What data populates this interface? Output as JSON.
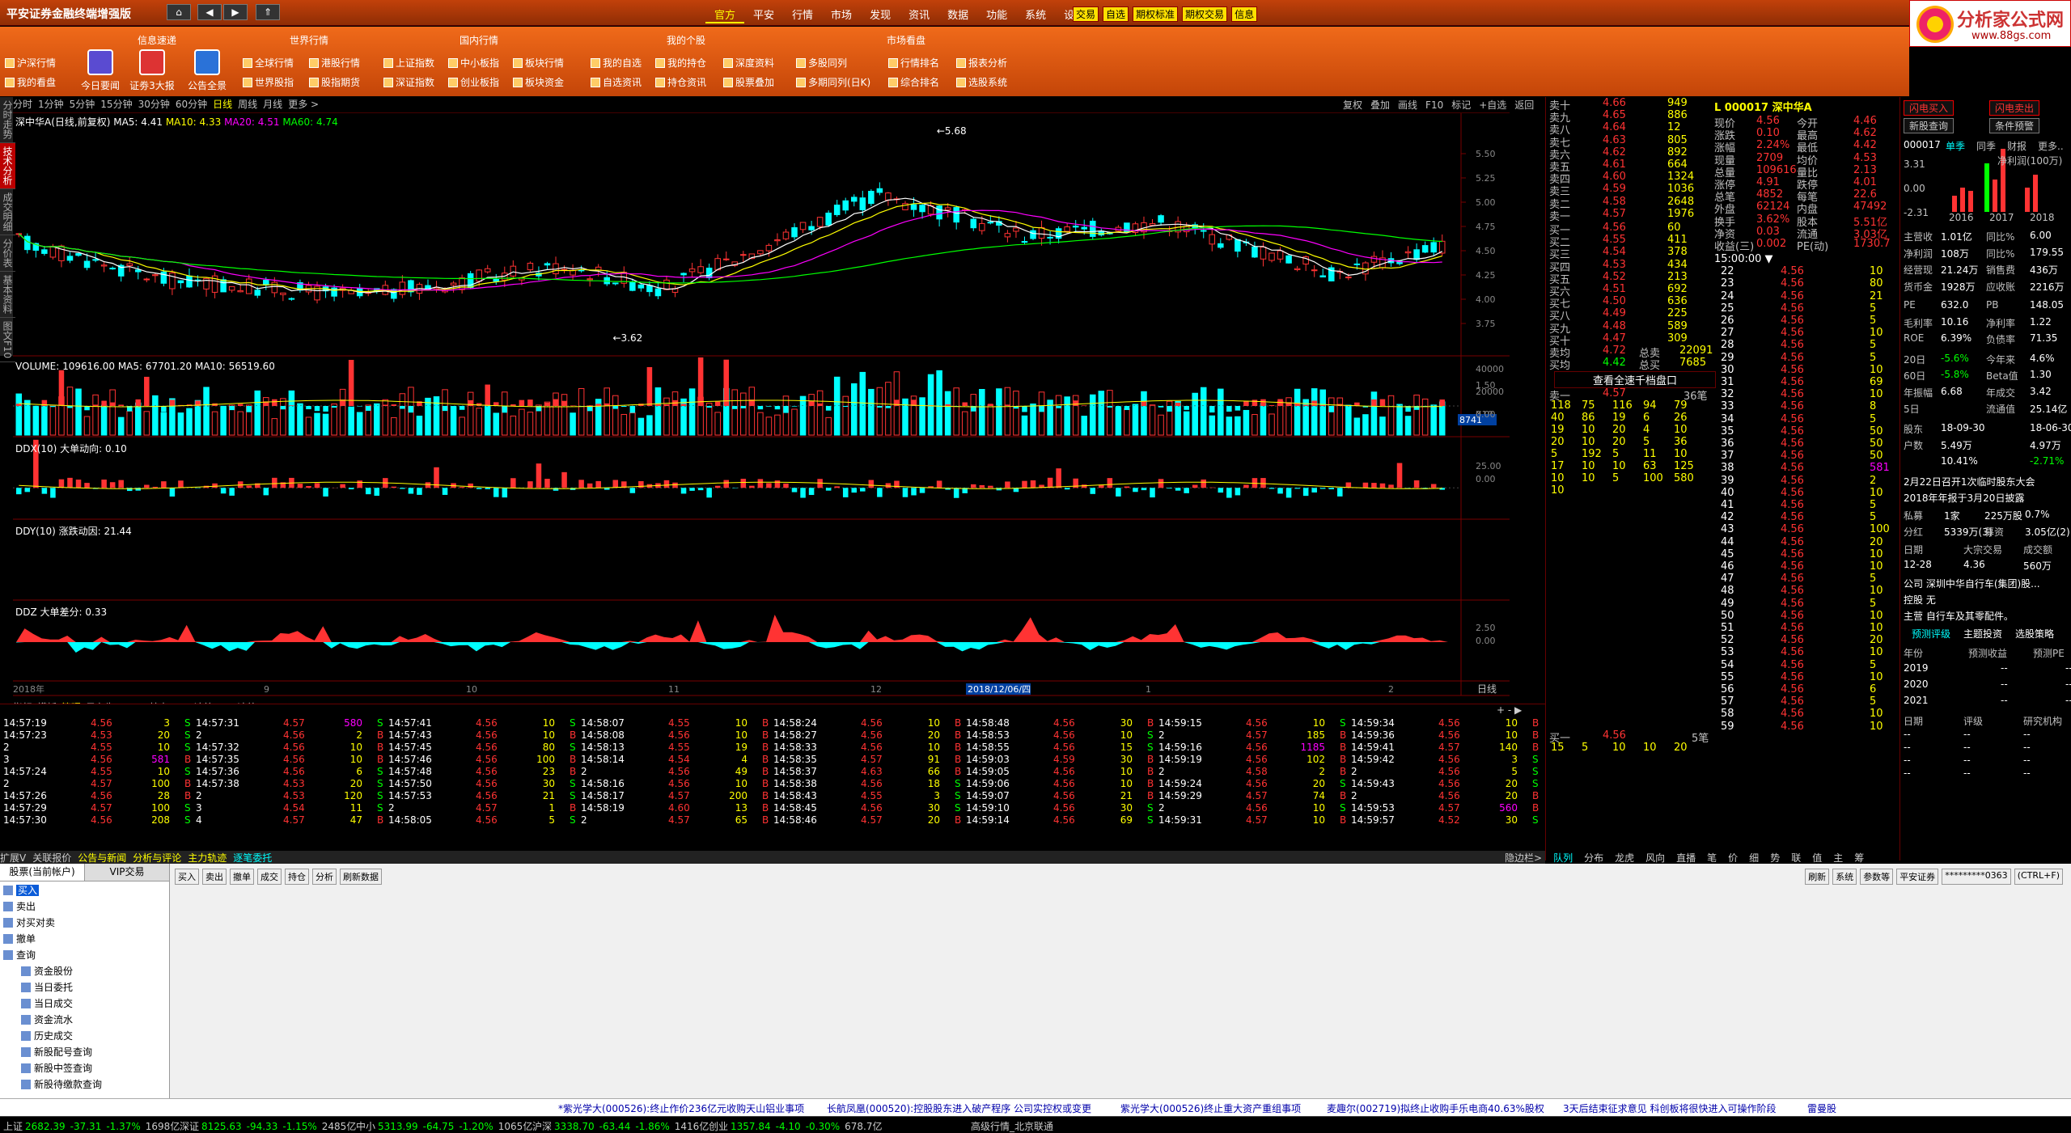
{
  "app": {
    "title": "平安证券金融终端增强版"
  },
  "top_menu": [
    "官方",
    "平安",
    "行情",
    "市场",
    "发现",
    "资讯",
    "数据",
    "功能",
    "系统",
    "设置"
  ],
  "top_flags": [
    "交易",
    "自选",
    "期权标准",
    "期权交易",
    "信息"
  ],
  "logo": {
    "line1": "分析家公式网",
    "line2": "www.88gs.com"
  },
  "toolbar": {
    "groups": [
      {
        "title": "信息速递",
        "items": [
          "沪深行情",
          "我的看盘"
        ],
        "big": [
          "今日要闻",
          "证劵3大报",
          "公告全景"
        ]
      },
      {
        "title": "世界行情",
        "items": [
          "全球行情",
          "世界股指",
          "港股行情",
          "股指期货"
        ]
      },
      {
        "title": "国内行情",
        "items": [
          "上证指数",
          "深证指数",
          "中小板指",
          "创业板指",
          "板块行情",
          "板块资金"
        ]
      },
      {
        "title": "我的个股",
        "items": [
          "我的自选",
          "自选资讯",
          "我的持仓",
          "持仓资讯",
          "深度资料",
          "股票叠加"
        ]
      },
      {
        "title": "市场看盘",
        "items": [
          "多股同列",
          "多期同列(日K)",
          "行情排名",
          "综合排名",
          "报表分析",
          "选股系统"
        ]
      }
    ]
  },
  "left_tabs": [
    "分时走势",
    "技术分析",
    "成交明细",
    "分价表",
    "基本资料",
    "图文F10"
  ],
  "period_bar": [
    "分时",
    "1分钟",
    "5分钟",
    "15分钟",
    "30分钟",
    "60分钟",
    "日线",
    "周线",
    "月线",
    "更多 >"
  ],
  "right_tools": [
    "复权",
    "叠加",
    "画线",
    "F10",
    "标记",
    "+自选",
    "返回"
  ],
  "main_chart": {
    "label": "深中华A(日线,前复权)",
    "ma5": "MA5: 4.41",
    "ma10": "MA10: 4.33",
    "ma20": "MA20: 4.51",
    "ma60": "MA60: 4.74",
    "high_label": "5.68",
    "low_label": "3.62",
    "y_ticks": [
      "5.50",
      "5.25",
      "5.00",
      "4.75",
      "4.50",
      "4.25",
      "4.00",
      "3.75"
    ]
  },
  "volume": {
    "label": "VOLUME: 109616.00  MA5: 67701.20  MA10: 56519.60",
    "y_ticks": [
      "40000",
      "20000",
      "X10"
    ],
    "badge": "8741"
  },
  "ddx": {
    "label": "DDX(10)  大单动向: 0.10",
    "y_ticks": [
      "1.50",
      "0.00"
    ]
  },
  "ddy": {
    "label": "DDY(10)  涨跌动因: 21.44",
    "y_ticks": [
      "25.00",
      "0.00"
    ]
  },
  "ddz": {
    "label": "DDZ  大单差分: 0.33",
    "y_ticks": [
      "2.50",
      "0.00"
    ]
  },
  "x_axis": {
    "labels": [
      "2018年",
      "9",
      "10",
      "11",
      "12",
      "2018/12/06/四",
      "1",
      "2"
    ],
    "period": "日线"
  },
  "ind_tabs": [
    "指标",
    "模板",
    "管理",
    "另存为",
    "MACD基本",
    "DDE决策",
    "SUP决策"
  ],
  "chart_data": {
    "type": "candlestick",
    "title": "深中华A(日线,前复权)",
    "ylim": [
      3.5,
      5.75
    ],
    "series": [
      {
        "name": "MA5"
      },
      {
        "name": "MA10"
      },
      {
        "name": "MA20"
      },
      {
        "name": "MA60"
      }
    ],
    "annotations": [
      {
        "text": "5.68",
        "kind": "high"
      },
      {
        "text": "3.62",
        "kind": "low"
      }
    ]
  },
  "quote": {
    "code": "000017",
    "name": "深中华A",
    "sells": [
      [
        "卖十",
        "4.66",
        "949"
      ],
      [
        "卖九",
        "4.65",
        "886"
      ],
      [
        "卖八",
        "4.64",
        "12"
      ],
      [
        "卖七",
        "4.63",
        "805"
      ],
      [
        "卖六",
        "4.62",
        "892"
      ],
      [
        "卖五",
        "4.61",
        "664"
      ],
      [
        "卖四",
        "4.60",
        "1324"
      ],
      [
        "卖三",
        "4.59",
        "1036"
      ],
      [
        "卖二",
        "4.58",
        "2648"
      ],
      [
        "卖一",
        "4.57",
        "1976"
      ]
    ],
    "buys": [
      [
        "买一",
        "4.56",
        "60"
      ],
      [
        "买二",
        "4.55",
        "411"
      ],
      [
        "买三",
        "4.54",
        "378"
      ],
      [
        "买四",
        "4.53",
        "434"
      ],
      [
        "买五",
        "4.52",
        "213"
      ],
      [
        "买六",
        "4.51",
        "692"
      ],
      [
        "买七",
        "4.50",
        "636"
      ],
      [
        "买八",
        "4.49",
        "225"
      ],
      [
        "买九",
        "4.48",
        "589"
      ],
      [
        "买十",
        "4.47",
        "309"
      ]
    ],
    "avg_sell": [
      "卖均",
      "4.72",
      "总卖",
      "22091"
    ],
    "avg_buy": [
      "买均",
      "4.42",
      "总买",
      "7685"
    ],
    "full_depth_btn": "查看全速千档盘口",
    "queue_head": [
      "卖一",
      "4.57",
      "36笔"
    ],
    "queue_rows": [
      [
        "118",
        "75",
        "116",
        "94",
        "79"
      ],
      [
        "40",
        "86",
        "19",
        "6",
        "26"
      ],
      [
        "19",
        "10",
        "20",
        "4",
        "10"
      ],
      [
        "20",
        "10",
        "20",
        "5",
        "36"
      ],
      [
        "5",
        "192",
        "5",
        "11",
        "10"
      ],
      [
        "17",
        "10",
        "10",
        "63",
        "125"
      ],
      [
        "10",
        "10",
        "5",
        "100",
        "580"
      ],
      [
        "10",
        "",
        "",
        "",
        ""
      ]
    ],
    "buy_queue_head": [
      "买一",
      "4.56",
      "5笔"
    ],
    "buy_queue_row": [
      "15",
      "5",
      "10",
      "10",
      "20"
    ],
    "stats": [
      [
        "现价",
        "4.56",
        "今开",
        "4.46"
      ],
      [
        "涨跌",
        "0.10",
        "最高",
        "4.62"
      ],
      [
        "涨幅",
        "2.24%",
        "最低",
        "4.42"
      ],
      [
        "现量",
        "2709",
        "均价",
        "4.53"
      ],
      [
        "总量",
        "109616",
        "量比",
        "2.13"
      ],
      [
        "涨停",
        "4.91",
        "跌停",
        "4.01"
      ],
      [
        "总笔",
        "4852",
        "每笔",
        "22.6"
      ],
      [
        "外盘",
        "62124",
        "内盘",
        "47492"
      ],
      [
        "换手",
        "3.62%",
        "股本",
        "5.51亿"
      ],
      [
        "净资",
        "0.03",
        "流通",
        "3.03亿"
      ],
      [
        "收益(三)",
        "0.002",
        "PE(动)",
        "1730.7"
      ]
    ],
    "ticks_head": "15:00:00",
    "ticks": [
      [
        "22",
        "4.56",
        "10"
      ],
      [
        "23",
        "4.56",
        "80"
      ],
      [
        "24",
        "4.56",
        "21"
      ],
      [
        "25",
        "4.56",
        "5"
      ],
      [
        "26",
        "4.56",
        "5"
      ],
      [
        "27",
        "4.56",
        "10"
      ],
      [
        "28",
        "4.56",
        "5"
      ],
      [
        "29",
        "4.56",
        "5"
      ],
      [
        "30",
        "4.56",
        "10"
      ],
      [
        "31",
        "4.56",
        "69"
      ],
      [
        "32",
        "4.56",
        "10"
      ],
      [
        "33",
        "4.56",
        "8"
      ],
      [
        "34",
        "4.56",
        "5"
      ],
      [
        "35",
        "4.56",
        "50"
      ],
      [
        "36",
        "4.56",
        "50"
      ],
      [
        "37",
        "4.56",
        "50"
      ],
      [
        "38",
        "4.56",
        "581"
      ],
      [
        "39",
        "4.56",
        "2"
      ],
      [
        "40",
        "4.56",
        "10"
      ],
      [
        "41",
        "4.56",
        "5"
      ],
      [
        "42",
        "4.56",
        "5"
      ],
      [
        "43",
        "4.56",
        "100"
      ],
      [
        "44",
        "4.56",
        "20"
      ],
      [
        "45",
        "4.56",
        "10"
      ],
      [
        "46",
        "4.56",
        "10"
      ],
      [
        "47",
        "4.56",
        "5"
      ],
      [
        "48",
        "4.56",
        "10"
      ],
      [
        "49",
        "4.56",
        "5"
      ],
      [
        "50",
        "4.56",
        "10"
      ],
      [
        "51",
        "4.56",
        "10"
      ],
      [
        "52",
        "4.56",
        "20"
      ],
      [
        "53",
        "4.56",
        "10"
      ],
      [
        "54",
        "4.56",
        "5"
      ],
      [
        "55",
        "4.56",
        "10"
      ],
      [
        "56",
        "4.56",
        "6"
      ],
      [
        "57",
        "4.56",
        "5"
      ],
      [
        "58",
        "4.56",
        "10"
      ],
      [
        "59",
        "4.56",
        "10"
      ]
    ]
  },
  "info": {
    "buttons": [
      "闪电买入",
      "闪电卖出",
      "新股查询",
      "条件预警"
    ],
    "code": "000017",
    "tabs": [
      "单季",
      "同季",
      "财报",
      "更多.."
    ],
    "mini_chart": {
      "unit": "净利润(100万)",
      "years": [
        "2016",
        "2017",
        "2018"
      ],
      "y_ticks": [
        "3.31",
        "0.00",
        "-2.31"
      ]
    },
    "rows": [
      [
        "主营收",
        "1.01亿",
        "同比%",
        "6.00"
      ],
      [
        "净利润",
        "108万",
        "同比%",
        "179.55"
      ],
      [
        "经营现",
        "21.24万",
        "销售费",
        "436万"
      ],
      [
        "货币金",
        "1928万",
        "应收账",
        "2216万"
      ],
      [
        "PE",
        "632.0",
        "PB",
        "148.05"
      ],
      [
        "毛利率",
        "10.16",
        "净利率",
        "1.22"
      ],
      [
        "ROE",
        "6.39%",
        "负债率",
        "71.35"
      ],
      [
        "20日",
        "-5.6%",
        "今年来",
        "4.6%"
      ],
      [
        "60日",
        "-5.8%",
        "Beta值",
        "1.30"
      ],
      [
        "年振幅",
        "6.68",
        "年成交",
        "3.42"
      ],
      [
        "5日",
        "",
        "流通值",
        "25.14亿"
      ],
      [
        "股东",
        "18-09-30",
        "",
        "18-06-30"
      ],
      [
        "户数",
        "5.49万",
        "",
        "4.97万"
      ],
      [
        "",
        "10.41%",
        "",
        "-2.71%"
      ]
    ],
    "meeting": "2月22日召开1次临时股东大会",
    "report": "2018年年报于3月20日披露",
    "pledge": [
      "私募",
      "1家",
      "225万股",
      "0.7%"
    ],
    "dividend": [
      "分红",
      "5339万(3)",
      "募资",
      "3.05亿(2)"
    ],
    "block": [
      "日期",
      "大宗交易",
      "成交额"
    ],
    "block_row": [
      "12-28",
      "4.36",
      "560万"
    ],
    "company": "公司 深圳中华自行车(集团)股...",
    "control": "控股 无",
    "business": "主营 自行车及其零配件。",
    "forecast_tabs": [
      "预测评级",
      "主题投资",
      "选股策略"
    ],
    "forecast_head": [
      "年份",
      "预测收益",
      "预测PE"
    ],
    "forecast_rows": [
      [
        "2019",
        "--",
        "--"
      ],
      [
        "2020",
        "--",
        "--"
      ],
      [
        "2021",
        "--",
        "--"
      ]
    ],
    "rating_head": [
      "日期",
      "评级",
      "研究机构"
    ],
    "rating_rows": [
      [
        "--",
        "--",
        "--"
      ],
      [
        "--",
        "--",
        "--"
      ],
      [
        "--",
        "--",
        "--"
      ],
      [
        "--",
        "--",
        "--"
      ]
    ]
  },
  "trades": [
    [
      [
        "14:57:19",
        "4.56",
        "3",
        "S"
      ],
      [
        "14:57:23",
        "4.53",
        "20",
        "S"
      ],
      [
        "2",
        "4.55",
        "10",
        "S"
      ],
      [
        "3",
        "4.56",
        "581",
        "B"
      ],
      [
        "14:57:24",
        "4.55",
        "10",
        "S"
      ],
      [
        "2",
        "4.57",
        "100",
        "B"
      ],
      [
        "14:57:26",
        "4.56",
        "28",
        "B"
      ],
      [
        "14:57:29",
        "4.57",
        "100",
        "S"
      ],
      [
        "14:57:30",
        "4.56",
        "208",
        "S"
      ]
    ],
    [
      [
        "14:57:31",
        "4.57",
        "580",
        "S"
      ],
      [
        "2",
        "4.56",
        "2",
        "B"
      ],
      [
        "14:57:32",
        "4.56",
        "10",
        "B"
      ],
      [
        "14:57:35",
        "4.56",
        "10",
        "B"
      ],
      [
        "14:57:36",
        "4.56",
        "6",
        "S"
      ],
      [
        "14:57:38",
        "4.53",
        "20",
        "S"
      ],
      [
        "2",
        "4.53",
        "120",
        "S"
      ],
      [
        "3",
        "4.54",
        "11",
        "S"
      ],
      [
        "4",
        "4.57",
        "47",
        "B"
      ]
    ],
    [
      [
        "14:57:41",
        "4.56",
        "10",
        "S"
      ],
      [
        "14:57:43",
        "4.56",
        "10",
        "B"
      ],
      [
        "14:57:45",
        "4.56",
        "80",
        "S"
      ],
      [
        "14:57:46",
        "4.56",
        "100",
        "B"
      ],
      [
        "14:57:48",
        "4.56",
        "23",
        "B"
      ],
      [
        "14:57:50",
        "4.56",
        "30",
        "S"
      ],
      [
        "14:57:53",
        "4.56",
        "21",
        "S"
      ],
      [
        "2",
        "4.57",
        "1",
        "B"
      ],
      [
        "14:58:05",
        "4.56",
        "5",
        "S"
      ]
    ],
    [
      [
        "14:58:07",
        "4.55",
        "10",
        "B"
      ],
      [
        "14:58:08",
        "4.56",
        "10",
        "B"
      ],
      [
        "14:58:13",
        "4.55",
        "19",
        "B"
      ],
      [
        "14:58:14",
        "4.54",
        "4",
        "B"
      ],
      [
        "2",
        "4.56",
        "49",
        "B"
      ],
      [
        "14:58:16",
        "4.56",
        "10",
        "B"
      ],
      [
        "14:58:17",
        "4.57",
        "200",
        "B"
      ],
      [
        "14:58:19",
        "4.60",
        "13",
        "B"
      ],
      [
        "2",
        "4.57",
        "65",
        "B"
      ]
    ],
    [
      [
        "14:58:24",
        "4.56",
        "10",
        "B"
      ],
      [
        "14:58:27",
        "4.56",
        "20",
        "B"
      ],
      [
        "14:58:33",
        "4.56",
        "10",
        "B"
      ],
      [
        "14:58:35",
        "4.57",
        "91",
        "B"
      ],
      [
        "14:58:37",
        "4.63",
        "66",
        "B"
      ],
      [
        "14:58:38",
        "4.56",
        "18",
        "S"
      ],
      [
        "14:58:43",
        "4.55",
        "3",
        "S"
      ],
      [
        "14:58:45",
        "4.56",
        "30",
        "S"
      ],
      [
        "14:58:46",
        "4.57",
        "20",
        "B"
      ]
    ],
    [
      [
        "14:58:48",
        "4.56",
        "30",
        "B"
      ],
      [
        "14:58:53",
        "4.56",
        "10",
        "S"
      ],
      [
        "14:58:55",
        "4.56",
        "15",
        "S"
      ],
      [
        "14:59:03",
        "4.59",
        "30",
        "B"
      ],
      [
        "14:59:05",
        "4.56",
        "10",
        "B"
      ],
      [
        "14:59:06",
        "4.56",
        "10",
        "B"
      ],
      [
        "14:59:07",
        "4.56",
        "21",
        "B"
      ],
      [
        "14:59:10",
        "4.56",
        "30",
        "S"
      ],
      [
        "14:59:14",
        "4.56",
        "69",
        "S"
      ]
    ],
    [
      [
        "14:59:15",
        "4.56",
        "10",
        "S"
      ],
      [
        "2",
        "4.57",
        "185",
        "B"
      ],
      [
        "14:59:16",
        "4.56",
        "1185",
        "B"
      ],
      [
        "14:59:19",
        "4.56",
        "102",
        "B"
      ],
      [
        "2",
        "4.58",
        "2",
        "B"
      ],
      [
        "14:59:24",
        "4.56",
        "20",
        "S"
      ],
      [
        "14:59:29",
        "4.57",
        "74",
        "B"
      ],
      [
        "2",
        "4.56",
        "10",
        "S"
      ],
      [
        "14:59:31",
        "4.57",
        "10",
        "B"
      ]
    ],
    [
      [
        "14:59:34",
        "4.56",
        "10",
        "B"
      ],
      [
        "14:59:36",
        "4.56",
        "10",
        "B"
      ],
      [
        "14:59:41",
        "4.57",
        "140",
        "B"
      ],
      [
        "14:59:42",
        "4.56",
        "3",
        "S"
      ],
      [
        "2",
        "4.56",
        "5",
        "S"
      ],
      [
        "14:59:43",
        "4.56",
        "20",
        "S"
      ],
      [
        "2",
        "4.56",
        "20",
        "B"
      ],
      [
        "14:59:53",
        "4.57",
        "560",
        "B"
      ],
      [
        "14:59:57",
        "4.52",
        "30",
        "S"
      ]
    ]
  ],
  "bottom_tabs": [
    "扩展V",
    "关联报价",
    "公告与新闻",
    "分析与评论",
    "主力轨迹",
    "逐笔委托"
  ],
  "right_bottom_tabs": [
    "隐边栏>",
    "队列",
    "分布",
    "龙虎",
    "风向",
    "直播",
    "笔",
    "价",
    "细",
    "势",
    "联",
    "值",
    "主",
    "筹"
  ],
  "trader": {
    "tabs": [
      "股票(当前帐户)",
      "VIP交易"
    ],
    "tree": [
      "买入",
      "卖出",
      "对买对卖",
      "撤单",
      "查询",
      "资金股份",
      "当日委托",
      "当日成交",
      "资金流水",
      "历史成交",
      "新股配号查询",
      "新股中签查询",
      "新股待缴款查询"
    ],
    "toolbar": [
      "买入",
      "卖出",
      "撤单",
      "成交",
      "持仓",
      "分析",
      "刷新数据"
    ],
    "right_tools": [
      "刷新",
      "系统",
      "参数等",
      "平安证券",
      "*********0363",
      "(CTRL+F)"
    ]
  },
  "news": [
    "*紫光学大(000526):终止作价236亿元收购天山铝业事项",
    "长航凤凰(000520):控股股东进入破产程序 公司实控权或变更",
    "紫光学大(000526)终止重大资产重组事项",
    "麦趣尔(002719)拟终止收购手乐电商40.63%股权",
    "3天后结束征求意见 科创板将很快进入可操作阶段",
    "雷曼股"
  ],
  "status": [
    {
      "name": "上证",
      "val": "2682.39",
      "chg": "-37.31",
      "pct": "-1.37%",
      "amt": "1698亿"
    },
    {
      "name": "深证",
      "val": "8125.63",
      "chg": "-94.33",
      "pct": "-1.15%",
      "amt": "2485亿"
    },
    {
      "name": "中小",
      "val": "5313.99",
      "chg": "-64.75",
      "pct": "-1.20%",
      "amt": "1065亿"
    },
    {
      "name": "沪深",
      "val": "3338.70",
      "chg": "-63.44",
      "pct": "-1.86%",
      "amt": "1416亿"
    },
    {
      "name": "创业",
      "val": "1357.84",
      "chg": "-4.10",
      "pct": "-0.30%",
      "amt": "678.7亿"
    }
  ],
  "status_right": "高级行情_北京联通",
  "colors": {
    "up": "#ff3333",
    "down": "#00ffff",
    "ma5": "#ffffff",
    "ma10": "#ffff00",
    "ma20": "#ff00ff",
    "ma60": "#00ff00",
    "accent": "#e0600f"
  }
}
